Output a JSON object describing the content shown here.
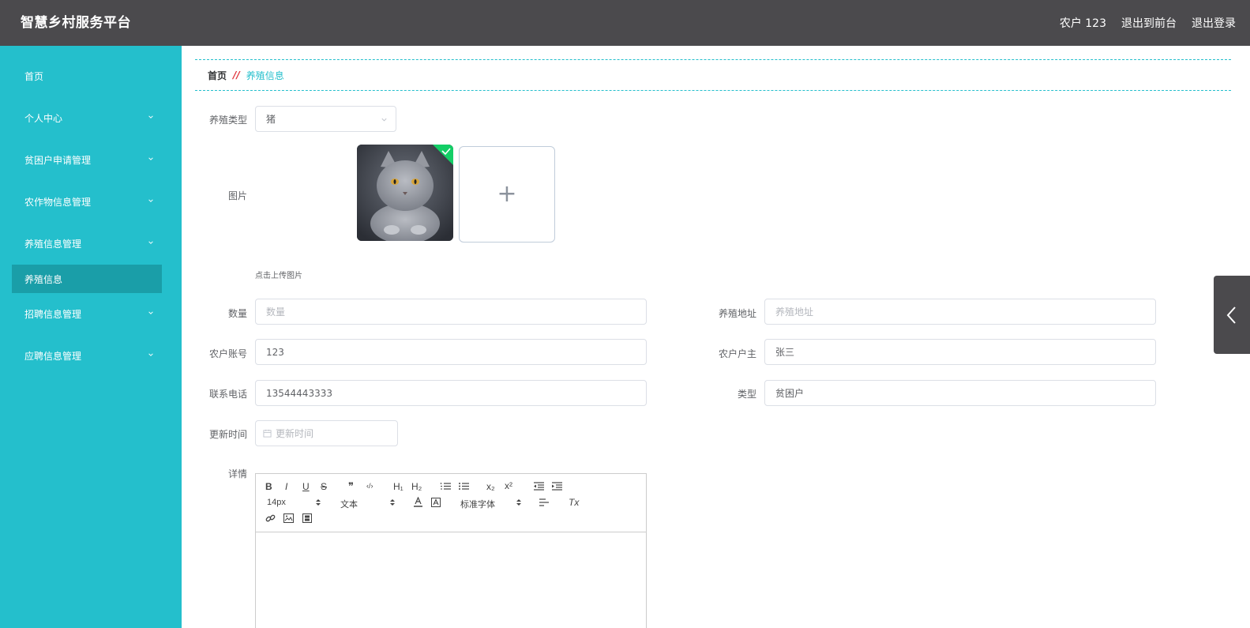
{
  "header": {
    "title": "智慧乡村服务平台",
    "user": "农户 123",
    "to_front": "退出到前台",
    "logout": "退出登录"
  },
  "sidebar": {
    "items": [
      {
        "label": "首页",
        "has_children": false
      },
      {
        "label": "个人中心",
        "has_children": true
      },
      {
        "label": "贫困户申请管理",
        "has_children": true
      },
      {
        "label": "农作物信息管理",
        "has_children": true
      },
      {
        "label": "养殖信息管理",
        "has_children": true
      },
      {
        "label": "养殖信息",
        "has_children": false,
        "active": true
      },
      {
        "label": "招聘信息管理",
        "has_children": true
      },
      {
        "label": "应聘信息管理",
        "has_children": true
      }
    ]
  },
  "breadcrumb": {
    "home": "首页",
    "separator": "//",
    "current": "养殖信息"
  },
  "form": {
    "type_label": "养殖类型",
    "type_value": "猪",
    "image_label": "图片",
    "upload_hint": "点击上传图片",
    "upload_plus": "+",
    "quantity_label": "数量",
    "quantity_placeholder": "数量",
    "address_label": "养殖地址",
    "address_placeholder": "养殖地址",
    "account_label": "农户账号",
    "account_value": "123",
    "owner_label": "农户户主",
    "owner_value": "张三",
    "phone_label": "联系电话",
    "phone_value": "13544443333",
    "category_label": "类型",
    "category_value": "贫困户",
    "time_label": "更新时间",
    "time_placeholder": "更新时间",
    "detail_label": "详情"
  },
  "editor": {
    "bold": "B",
    "italic": "I",
    "underline": "U",
    "strike": "S",
    "quote": "❞",
    "code": "‹/›",
    "h1": "H₁",
    "h2": "H₂",
    "sub": "x₂",
    "sup": "x²",
    "font_size": "14px",
    "text_style": "文本",
    "font_family": "标准字体",
    "clear": "Tx"
  },
  "colors": {
    "topbar": "#4b4a4d",
    "sidebar": "#24bfcc",
    "sidebar_active": "#1a9ea8",
    "accent": "#24bfcc",
    "separator": "#e0323a"
  }
}
